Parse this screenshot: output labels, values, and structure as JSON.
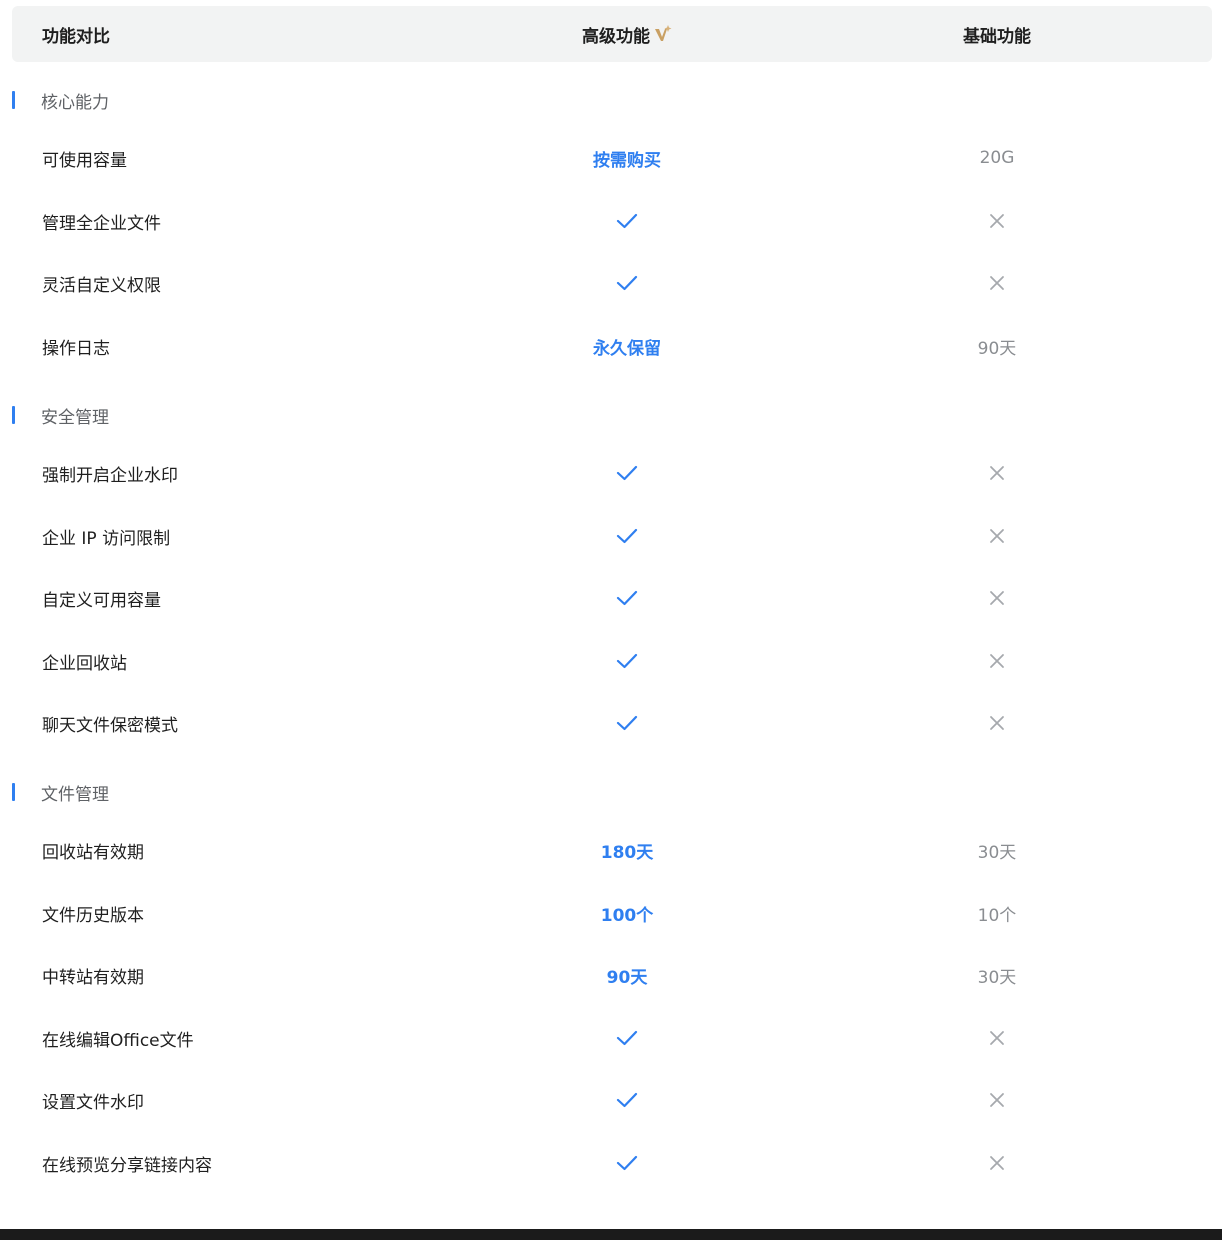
{
  "header": {
    "feature": "功能对比",
    "advanced": "高级功能",
    "basic": "基础功能"
  },
  "colors": {
    "accent": "#2f7ff0",
    "header_bg": "#f2f3f3",
    "muted": "#8a8d91",
    "vip_gold": "#c9a063"
  },
  "sections": [
    {
      "title": "核心能力",
      "rows": [
        {
          "name": "可使用容量",
          "advanced": {
            "type": "text",
            "text": "按需购买"
          },
          "basic": {
            "type": "text",
            "text": "20G"
          }
        },
        {
          "name": "管理全企业文件",
          "advanced": {
            "type": "icon",
            "icon": "check-icon"
          },
          "basic": {
            "type": "icon",
            "icon": "cross-icon"
          }
        },
        {
          "name": "灵活自定义权限",
          "advanced": {
            "type": "icon",
            "icon": "check-icon"
          },
          "basic": {
            "type": "icon",
            "icon": "cross-icon"
          }
        },
        {
          "name": "操作日志",
          "advanced": {
            "type": "text",
            "text": "永久保留"
          },
          "basic": {
            "type": "text",
            "text": "90天"
          }
        }
      ]
    },
    {
      "title": "安全管理",
      "rows": [
        {
          "name": "强制开启企业水印",
          "advanced": {
            "type": "icon",
            "icon": "check-icon"
          },
          "basic": {
            "type": "icon",
            "icon": "cross-icon"
          }
        },
        {
          "name": "企业 IP 访问限制",
          "advanced": {
            "type": "icon",
            "icon": "check-icon"
          },
          "basic": {
            "type": "icon",
            "icon": "cross-icon"
          }
        },
        {
          "name": "自定义可用容量",
          "advanced": {
            "type": "icon",
            "icon": "check-icon"
          },
          "basic": {
            "type": "icon",
            "icon": "cross-icon"
          }
        },
        {
          "name": "企业回收站",
          "advanced": {
            "type": "icon",
            "icon": "check-icon"
          },
          "basic": {
            "type": "icon",
            "icon": "cross-icon"
          }
        },
        {
          "name": "聊天文件保密模式",
          "advanced": {
            "type": "icon",
            "icon": "check-icon"
          },
          "basic": {
            "type": "icon",
            "icon": "cross-icon"
          }
        }
      ]
    },
    {
      "title": "文件管理",
      "rows": [
        {
          "name": "回收站有效期",
          "advanced": {
            "type": "text",
            "text": "180天"
          },
          "basic": {
            "type": "text",
            "text": "30天"
          }
        },
        {
          "name": "文件历史版本",
          "advanced": {
            "type": "text",
            "text": "100个"
          },
          "basic": {
            "type": "text",
            "text": "10个"
          }
        },
        {
          "name": "中转站有效期",
          "advanced": {
            "type": "text",
            "text": "90天"
          },
          "basic": {
            "type": "text",
            "text": "30天"
          }
        },
        {
          "name": "在线编辑Office文件",
          "advanced": {
            "type": "icon",
            "icon": "check-icon"
          },
          "basic": {
            "type": "icon",
            "icon": "cross-icon"
          }
        },
        {
          "name": "设置文件水印",
          "advanced": {
            "type": "icon",
            "icon": "check-icon"
          },
          "basic": {
            "type": "icon",
            "icon": "cross-icon"
          }
        },
        {
          "name": "在线预览分享链接内容",
          "advanced": {
            "type": "icon",
            "icon": "check-icon"
          },
          "basic": {
            "type": "icon",
            "icon": "cross-icon"
          }
        }
      ]
    }
  ]
}
